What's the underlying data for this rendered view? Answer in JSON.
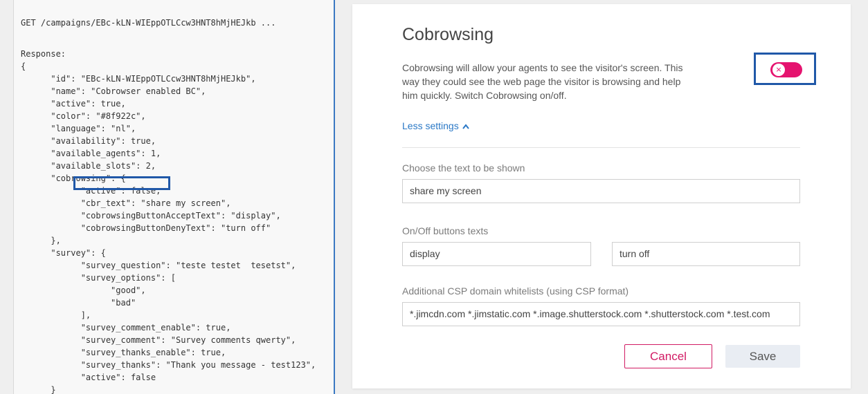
{
  "code_panel": {
    "lines": [
      "GET /campaigns/EBc-kLN-WIEppOTLCcw3HNT8hMjHEJkb ...",
      "",
      "Response:",
      "{",
      "      \"id\": \"EBc-kLN-WIEppOTLCcw3HNT8hMjHEJkb\",",
      "      \"name\": \"Cobrowser enabled BC\",",
      "      \"active\": true,",
      "      \"color\": \"#8f922c\",",
      "      \"language\": \"nl\",",
      "      \"availability\": true,",
      "      \"available_agents\": 1,",
      "      \"available_slots\": 2,",
      "      \"cobrowsing\": {",
      "            \"active\": false,",
      "            \"cbr_text\": \"share my screen\",",
      "            \"cobrowsingButtonAcceptText\": \"display\",",
      "            \"cobrowsingButtonDenyText\": \"turn off\"",
      "      },",
      "      \"survey\": {",
      "            \"survey_question\": \"teste testet  tesetst\",",
      "            \"survey_options\": [",
      "                  \"good\",",
      "                  \"bad\"",
      "            ],",
      "            \"survey_comment_enable\": true,",
      "            \"survey_comment\": \"Survey comments qwerty\",",
      "            \"survey_thanks_enable\": true,",
      "            \"survey_thanks\": \"Thank you message - test123\",",
      "            \"active\": false",
      "      }",
      "}"
    ]
  },
  "settings": {
    "title": "Cobrowsing",
    "description": "Cobrowsing will allow your agents to see the visitor's screen. This way they could see the web page the visitor is browsing and help him quickly. Switch Cobrowsing on/off.",
    "toggle_state": "off",
    "toggle_icon": "×",
    "less_settings_label": "Less settings",
    "text_label": "Choose the text to be shown",
    "text_value": "share my screen",
    "buttons_label": "On/Off buttons texts",
    "on_text_value": "display",
    "off_text_value": "turn off",
    "csp_label": "Additional CSP domain whitelists (using CSP format)",
    "csp_value": "*.jimcdn.com *.jimstatic.com *.image.shutterstock.com *.shutterstock.com *.test.com",
    "cancel_label": "Cancel",
    "save_label": "Save"
  },
  "colors": {
    "toggle_accent": "#e5136f",
    "cancel_accent": "#d11a63",
    "link": "#2a78c6",
    "highlight_box": "#2058a8"
  }
}
